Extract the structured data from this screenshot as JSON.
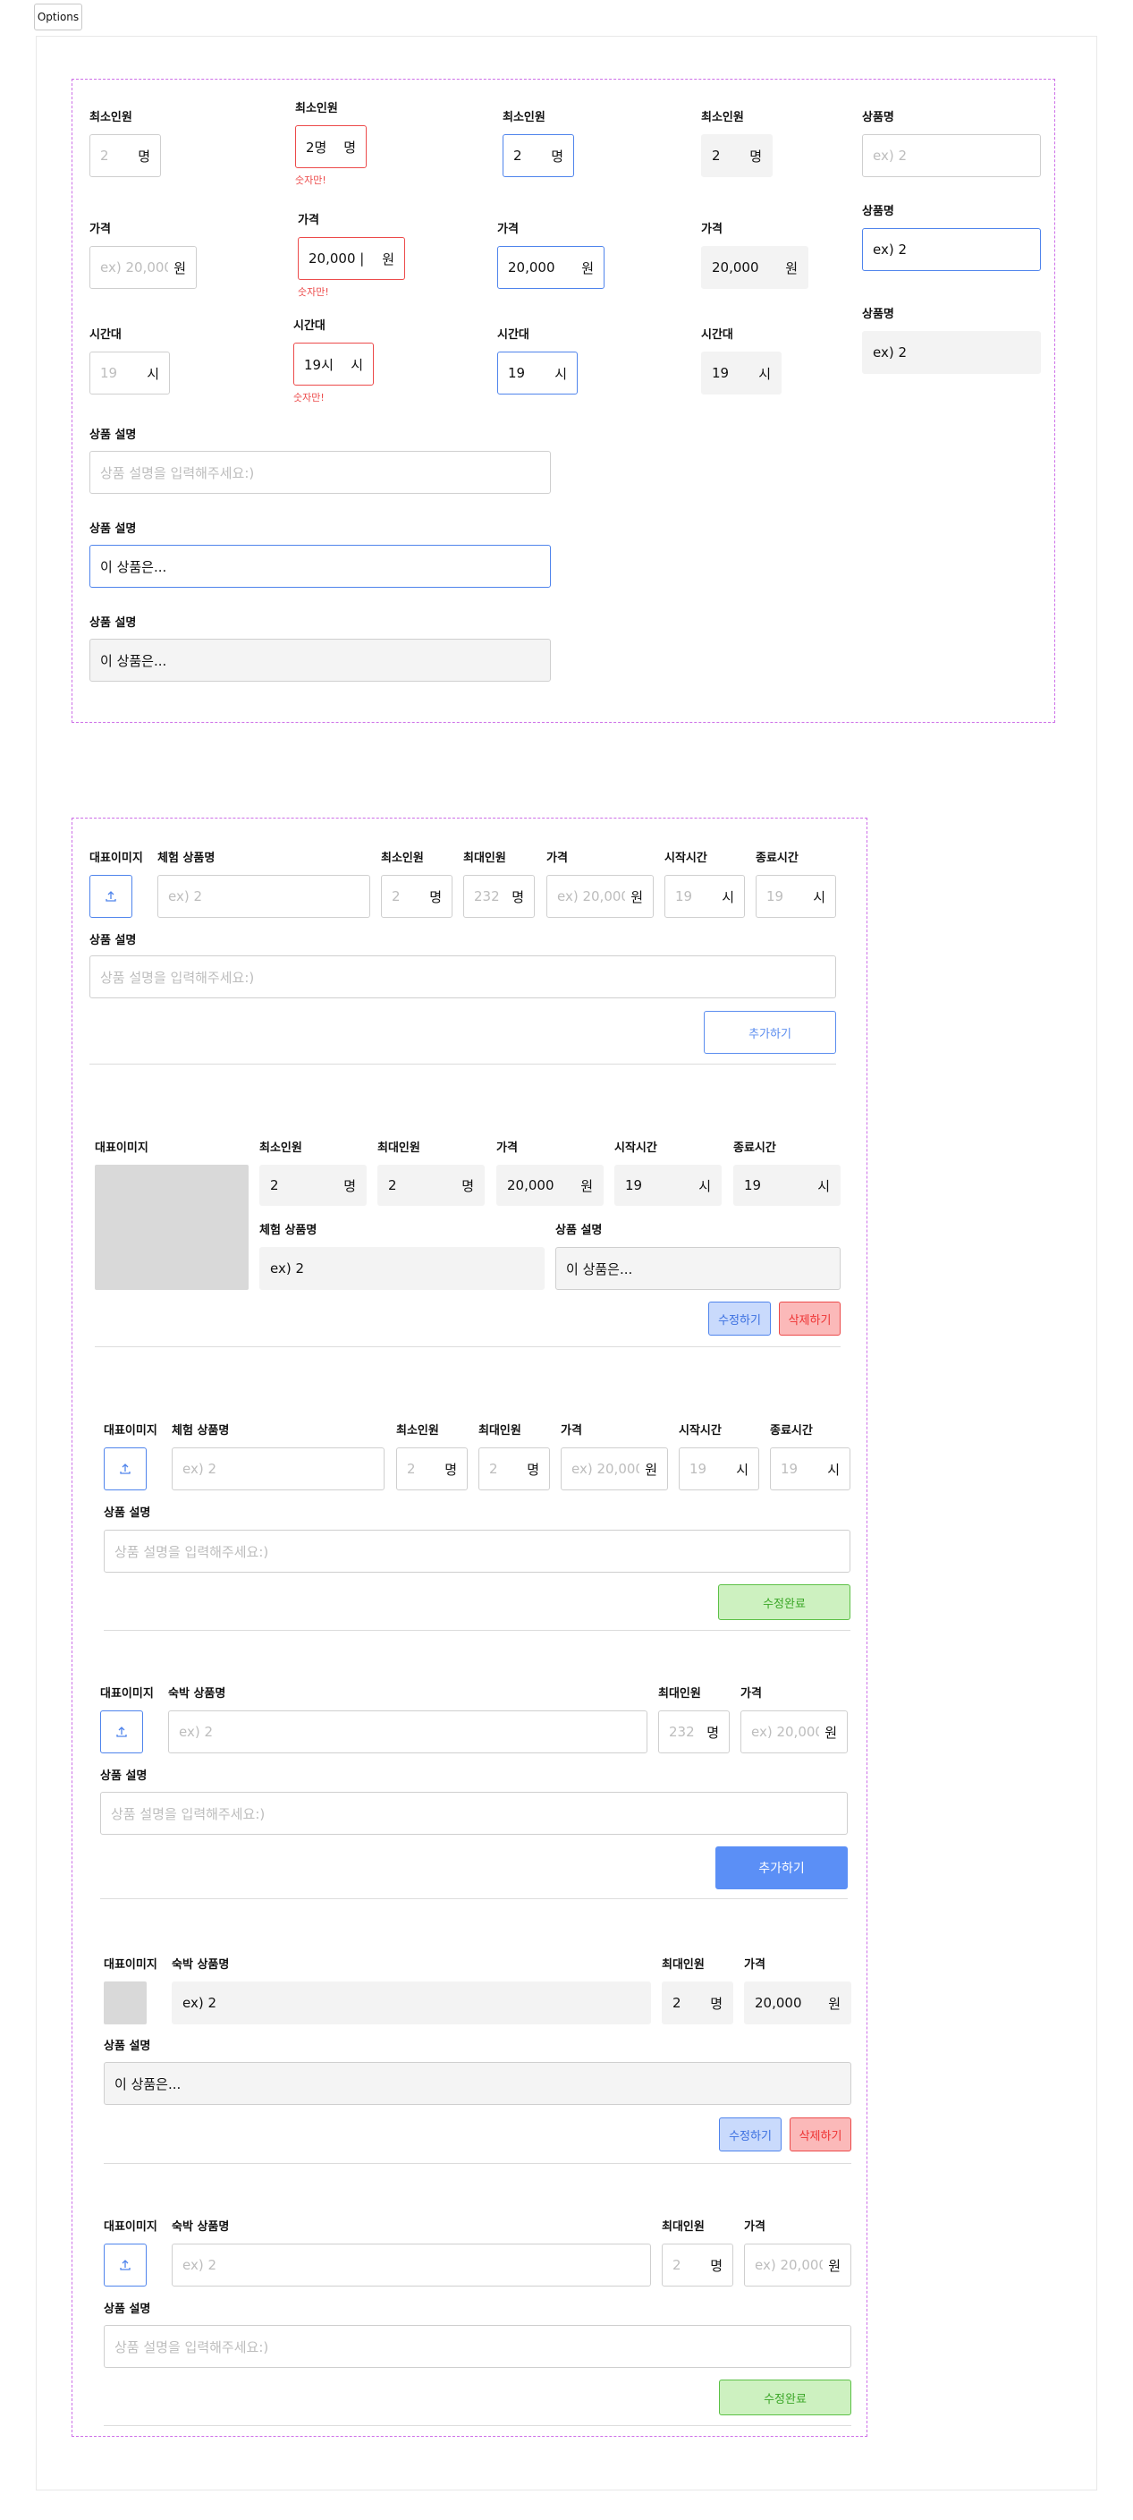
{
  "options_label": "Options",
  "labels": {
    "min": "최소인원",
    "max": "최대인원",
    "price": "가격",
    "time": "시간대",
    "start": "시작시간",
    "end": "종료시간",
    "pname": "상품명",
    "desc": "상품 설명",
    "image": "대표이미지",
    "exp_name": "체험 상품명",
    "stay_name": "숙박 상품명"
  },
  "units": {
    "person": "명",
    "won": "원",
    "hour": "시"
  },
  "placeholders": {
    "min": "2",
    "max": "232",
    "price": "ex) 20,000",
    "time": "19",
    "pname": "ex) 2",
    "desc": "상품 설명을 입력해주세요:)"
  },
  "values": {
    "min_err": "2명",
    "min": "2",
    "price_err": "20,000 |",
    "price": "20,000",
    "time_err": "19시",
    "time": "19",
    "pname": "ex) 2",
    "desc": "이 상품은..."
  },
  "error_text": "숫자만!",
  "buttons": {
    "add": "추가하기",
    "edit": "수정하기",
    "delete": "삭제하기",
    "done": "수정완료"
  },
  "colors": {
    "accent": "#4f84ec",
    "error": "#ec4a4a",
    "dashed_frame": "#cd6fe8",
    "success": "#5cc046"
  }
}
